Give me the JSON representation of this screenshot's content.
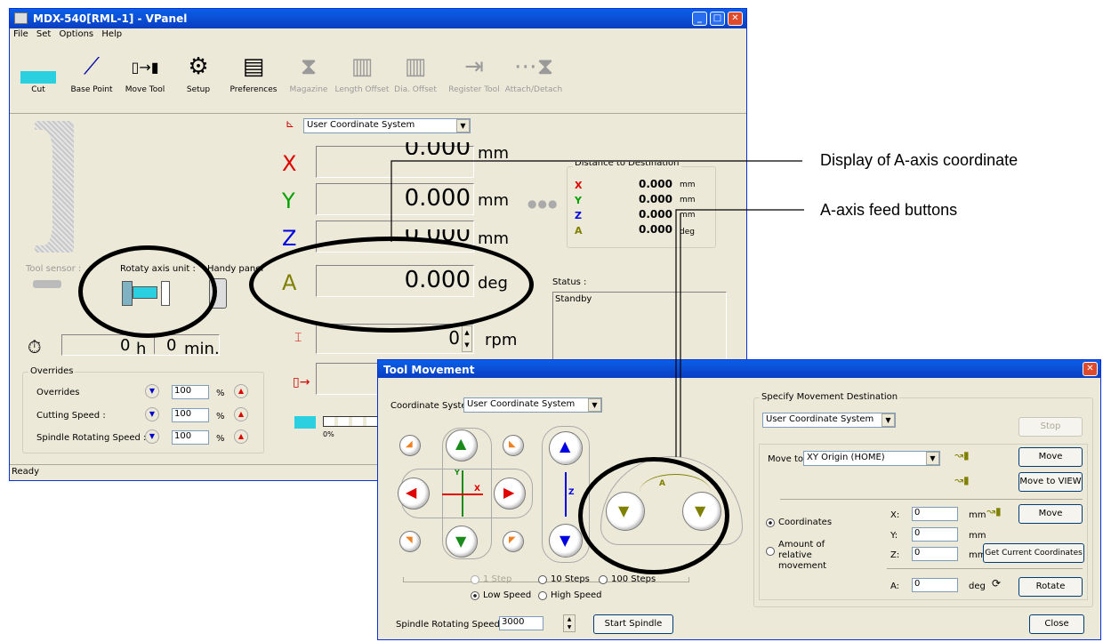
{
  "main_window": {
    "title": "MDX-540[RML-1] - VPanel",
    "menu": [
      "File",
      "Set",
      "Options",
      "Help"
    ],
    "toolbar": [
      {
        "label": "Cut",
        "icon": "cut-icon",
        "enabled": true
      },
      {
        "label": "Base Point",
        "icon": "base-point-icon",
        "enabled": true
      },
      {
        "label": "Move Tool",
        "icon": "move-tool-icon",
        "enabled": true
      },
      {
        "label": "Setup",
        "icon": "setup-icon",
        "enabled": true
      },
      {
        "label": "Preferences",
        "icon": "preferences-icon",
        "enabled": true
      },
      {
        "label": "Magazine",
        "icon": "magazine-icon",
        "enabled": false
      },
      {
        "label": "Length Offset",
        "icon": "length-offset-icon",
        "enabled": false
      },
      {
        "label": "Dia. Offset",
        "icon": "dia-offset-icon",
        "enabled": false
      },
      {
        "label": "Register Tool",
        "icon": "register-tool-icon",
        "enabled": false
      },
      {
        "label": "Attach/Detach",
        "icon": "attach-detach-icon",
        "enabled": false
      }
    ],
    "coord_system": "User Coordinate System",
    "coords": {
      "x": {
        "axis": "X",
        "value": "0.000",
        "unit": "mm",
        "color": "#e00000"
      },
      "y": {
        "axis": "Y",
        "value": "0.000",
        "unit": "mm",
        "color": "#00a000"
      },
      "z": {
        "axis": "Z",
        "value": "0.000",
        "unit": "mm",
        "color": "#0000e0"
      },
      "a": {
        "axis": "A",
        "value": "0.000",
        "unit": "deg",
        "color": "#808000"
      }
    },
    "distance": {
      "title": "Distance to Destination",
      "x": {
        "axis": "X",
        "value": "0.000",
        "unit": "mm"
      },
      "y": {
        "axis": "Y",
        "value": "0.000",
        "unit": "mm"
      },
      "z": {
        "axis": "Z",
        "value": "0.000",
        "unit": "mm"
      },
      "a": {
        "axis": "A",
        "value": "0.000",
        "unit": "deg"
      }
    },
    "devices": {
      "tool_sensor": "Tool sensor :",
      "rotary": "Rotaty axis unit :",
      "handy": "Handy panel"
    },
    "spindle": {
      "value": "0",
      "unit": "rpm"
    },
    "time": {
      "hours": "0",
      "h_unit": "h",
      "minutes": "0",
      "m_unit": "min."
    },
    "status": {
      "label": "Status :",
      "value": "Standby"
    },
    "overrides": {
      "title": "Overrides",
      "rows": [
        {
          "label": "Overrides",
          "value": "100",
          "unit": "%"
        },
        {
          "label": "Cutting Speed :",
          "value": "100",
          "unit": "%"
        },
        {
          "label": "Spindle Rotating Speed :",
          "value": "100",
          "unit": "%"
        }
      ]
    },
    "progress": {
      "percent": "0%",
      "value": 0
    },
    "statusbar": "Ready"
  },
  "dialog": {
    "title": "Tool Movement",
    "coord_label": "Coordinate System",
    "coord_value": "User Coordinate System",
    "steps": [
      "1 Step",
      "10 Steps",
      "100 Steps"
    ],
    "speeds": [
      "Low Speed",
      "High Speed"
    ],
    "spindle_label": "Spindle Rotating Speed",
    "spindle_value": "3000",
    "start_spindle": "Start Spindle",
    "dest": {
      "title": "Specify Movement Destination",
      "coord_value": "User Coordinate System",
      "stop": "Stop",
      "move_to_label": "Move to",
      "move_to_value": "XY Origin (HOME)",
      "move": "Move",
      "move_view": "Move to VIEW",
      "coordinates": "Coordinates",
      "relative": "Amount of relative movement",
      "fields": [
        {
          "label": "X:",
          "value": "0",
          "unit": "mm"
        },
        {
          "label": "Y:",
          "value": "0",
          "unit": "mm"
        },
        {
          "label": "Z:",
          "value": "0",
          "unit": "mm"
        }
      ],
      "move2": "Move",
      "get_current": "Get Current Coordinates",
      "a_label": "A:",
      "a_value": "0",
      "a_unit": "deg",
      "rotate": "Rotate"
    },
    "close": "Close",
    "a_label": "A",
    "x_label": "X",
    "y_label": "Y",
    "z_label": "Z"
  },
  "annotations": {
    "display": "Display of A-axis coordinate",
    "feed": "A-axis feed buttons"
  }
}
